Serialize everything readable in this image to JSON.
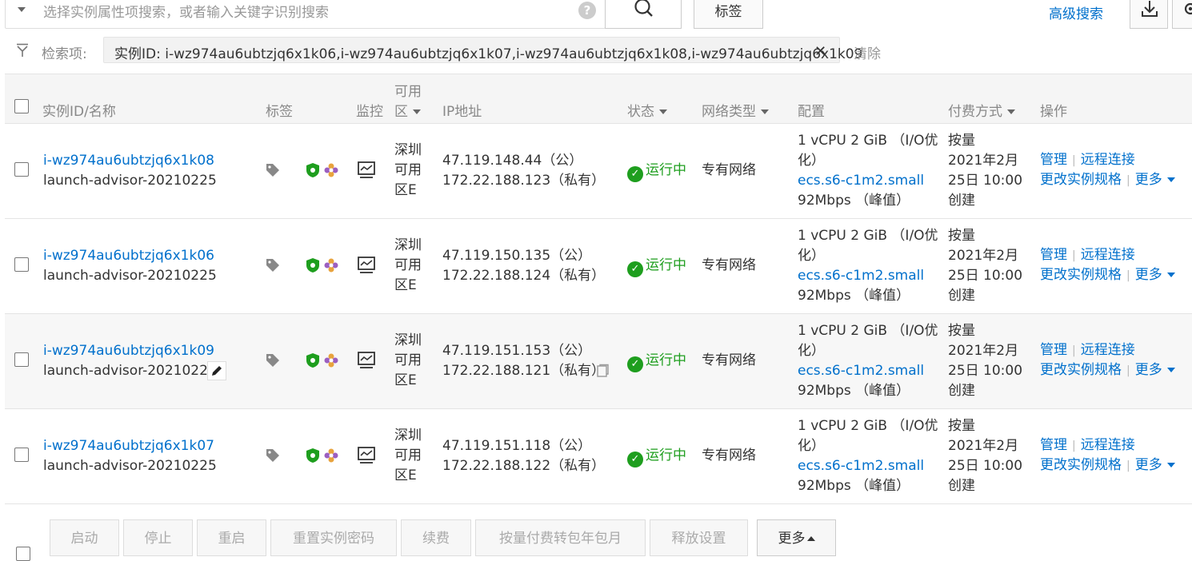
{
  "search": {
    "placeholder": "选择实例属性项搜索，或者输入关键字识别搜索",
    "help_glyph": "?",
    "tag_button": "标签",
    "advanced_search": "高级搜索"
  },
  "filter": {
    "label": "检索项:",
    "chip_text": "实例ID: i-wz974au6ubtzjq6x1k06,i-wz974au6ubtzjq6x1k07,i-wz974au6ubtzjq6x1k08,i-wz974au6ubtzjq6x1k09",
    "clear": "清除"
  },
  "table": {
    "headers": {
      "id_name": "实例ID/名称",
      "tags": "标签",
      "monitor": "监控",
      "zone_line1": "可用",
      "zone_line2": "区",
      "ip": "IP地址",
      "status": "状态",
      "network": "网络类型",
      "config": "配置",
      "billing": "付费方式",
      "actions": "操作"
    },
    "rows": [
      {
        "id": "i-wz974au6ubtzjq6x1k08",
        "name": "launch-advisor-20210225",
        "zone": [
          "深圳",
          "可用",
          "区E"
        ],
        "ip_public": "47.119.148.44（公）",
        "ip_private": "172.22.188.123（私有）",
        "status": "运行中",
        "network": "专有网络",
        "config_line1": "1 vCPU 2 GiB （I/O优",
        "config_line2": "化）",
        "instance_type": "ecs.s6-c1m2.small",
        "bandwidth": "92Mbps （峰值）",
        "billing": [
          "按量",
          "2021年2月",
          "25日 10:00",
          "创建"
        ],
        "action_manage": "管理",
        "action_remote": "远程连接",
        "action_resize": "更改实例规格",
        "action_more": "更多"
      },
      {
        "id": "i-wz974au6ubtzjq6x1k06",
        "name": "launch-advisor-20210225",
        "zone": [
          "深圳",
          "可用",
          "区E"
        ],
        "ip_public": "47.119.150.135（公）",
        "ip_private": "172.22.188.124（私有）",
        "status": "运行中",
        "network": "专有网络",
        "config_line1": "1 vCPU 2 GiB （I/O优",
        "config_line2": "化）",
        "instance_type": "ecs.s6-c1m2.small",
        "bandwidth": "92Mbps （峰值）",
        "billing": [
          "按量",
          "2021年2月",
          "25日 10:00",
          "创建"
        ],
        "action_manage": "管理",
        "action_remote": "远程连接",
        "action_resize": "更改实例规格",
        "action_more": "更多"
      },
      {
        "id": "i-wz974au6ubtzjq6x1k09",
        "name": "launch-advisor-20210225",
        "zone": [
          "深圳",
          "可用",
          "区E"
        ],
        "ip_public": "47.119.151.153（公）",
        "ip_private": "172.22.188.121（私有）",
        "status": "运行中",
        "network": "专有网络",
        "config_line1": "1 vCPU 2 GiB （I/O优",
        "config_line2": "化）",
        "instance_type": "ecs.s6-c1m2.small",
        "bandwidth": "92Mbps （峰值）",
        "billing": [
          "按量",
          "2021年2月",
          "25日 10:00",
          "创建"
        ],
        "action_manage": "管理",
        "action_remote": "远程连接",
        "action_resize": "更改实例规格",
        "action_more": "更多"
      },
      {
        "id": "i-wz974au6ubtzjq6x1k07",
        "name": "launch-advisor-20210225",
        "zone": [
          "深圳",
          "可用",
          "区E"
        ],
        "ip_public": "47.119.151.118（公）",
        "ip_private": "172.22.188.122（私有）",
        "status": "运行中",
        "network": "专有网络",
        "config_line1": "1 vCPU 2 GiB （I/O优",
        "config_line2": "化）",
        "instance_type": "ecs.s6-c1m2.small",
        "bandwidth": "92Mbps （峰值）",
        "billing": [
          "按量",
          "2021年2月",
          "25日 10:00",
          "创建"
        ],
        "action_manage": "管理",
        "action_remote": "远程连接",
        "action_resize": "更改实例规格",
        "action_more": "更多"
      }
    ]
  },
  "bottom_actions": [
    "启动",
    "停止",
    "重启",
    "重置实例密码",
    "续费",
    "按量付费转包年包月",
    "释放设置",
    "更多"
  ],
  "colors": {
    "link": "#0070cc",
    "status_running": "#1e9e1e",
    "shield": "#1e9e1e"
  }
}
